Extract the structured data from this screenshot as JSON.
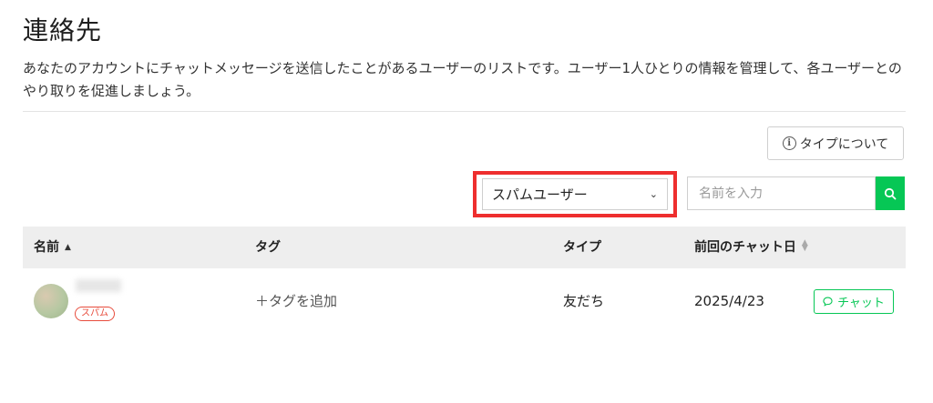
{
  "page": {
    "title": "連絡先",
    "description": "あなたのアカウントにチャットメッセージを送信したことがあるユーザーのリストです。ユーザー1人ひとりの情報を管理して、各ユーザーとのやり取りを促進しましょう。"
  },
  "toolbar": {
    "type_info_label": "タイプについて",
    "filter_selected": "スパムユーザー",
    "search_placeholder": "名前を入力"
  },
  "table": {
    "headers": {
      "name": "名前",
      "tag": "タグ",
      "type": "タイプ",
      "last_chat": "前回のチャット日"
    },
    "rows": [
      {
        "badge": "スパム",
        "add_tag": "＋タグを追加",
        "type": "友だち",
        "last_chat_date": "2025/4/23",
        "chat_label": "チャット"
      }
    ]
  },
  "colors": {
    "accent": "#06c755",
    "highlight": "#ee2e2e",
    "spam": "#e74c3c"
  }
}
